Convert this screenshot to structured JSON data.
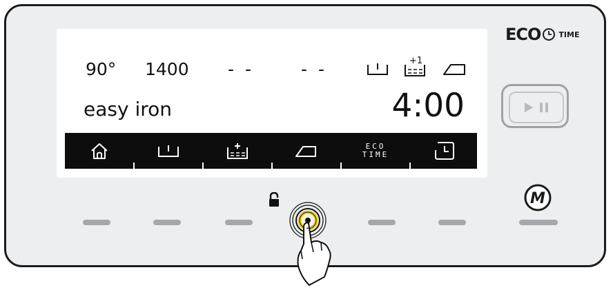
{
  "display": {
    "temperature": "90°",
    "spin_speed": "1400",
    "dashes_left": "- -",
    "dashes_right": "- -",
    "program_name": "easy iron",
    "remaining_time": "4:00",
    "plus_one_label": "+1"
  },
  "option_bar": {
    "items": [
      {
        "name": "home"
      },
      {
        "name": "prewash"
      },
      {
        "name": "extra-rinse"
      },
      {
        "name": "easy-iron"
      },
      {
        "name": "eco-time",
        "label_line1": "ECO",
        "label_line2": "TIME"
      },
      {
        "name": "delay-start"
      }
    ]
  },
  "logo": {
    "brand_big": "ECO",
    "brand_small": "TIME"
  },
  "controls": {
    "m_button_label": "M",
    "child_lock": "locked"
  },
  "colors": {
    "panel_bg": "#eceeef",
    "lcd_bg": "#ffffff",
    "option_bar_bg": "#0d0d0d",
    "touch_ring": "#e6d22a"
  }
}
